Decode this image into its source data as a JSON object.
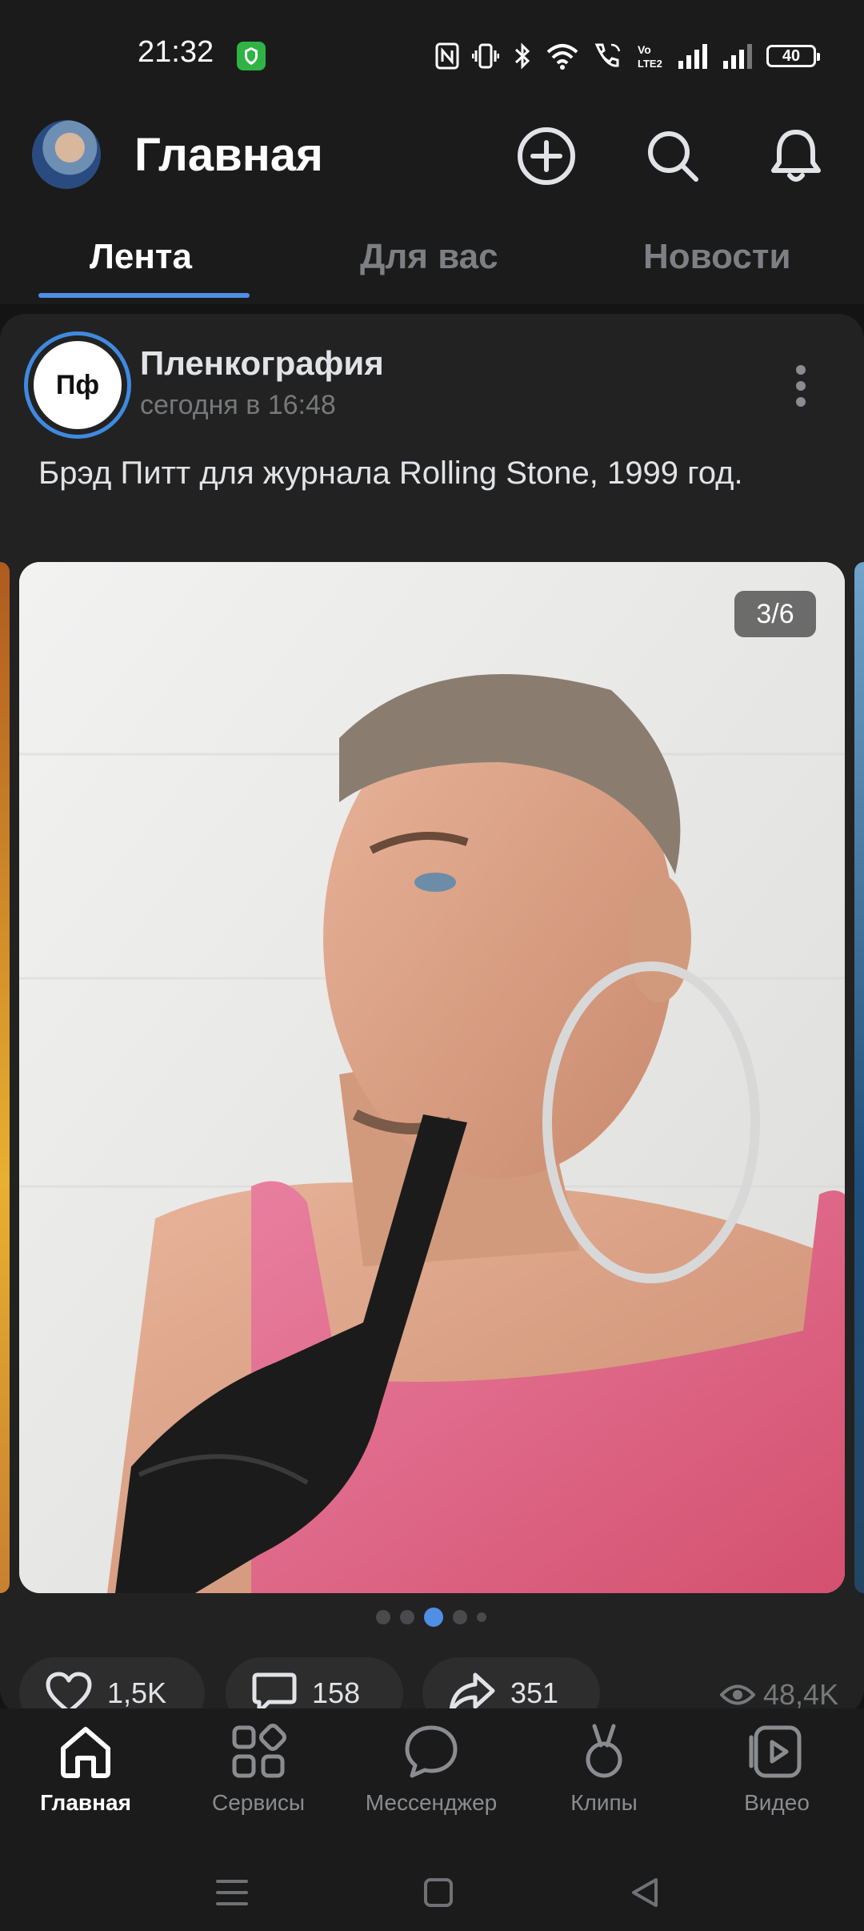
{
  "status_bar": {
    "time": "21:32",
    "battery": "40"
  },
  "header": {
    "title": "Главная"
  },
  "tabs": [
    {
      "label": "Лента"
    },
    {
      "label": "Для вас"
    },
    {
      "label": "Новости"
    }
  ],
  "post": {
    "group_initials": "Пф",
    "group_name": "Пленкография",
    "time": "сегодня в 16:48",
    "text": "Брэд Питт для журнала Rolling Stone, 1999 год.",
    "photo_counter": "3/6",
    "carousel": {
      "count": 5,
      "active_index": 2
    },
    "likes": "1,5K",
    "comments": "158",
    "shares": "351",
    "views": "48,4K"
  },
  "bottom_nav": [
    {
      "label": "Главная"
    },
    {
      "label": "Сервисы"
    },
    {
      "label": "Мессенджер"
    },
    {
      "label": "Клипы"
    },
    {
      "label": "Видео"
    }
  ],
  "colors": {
    "accent": "#4f8fe6",
    "background": "#141414",
    "card": "#222222"
  }
}
